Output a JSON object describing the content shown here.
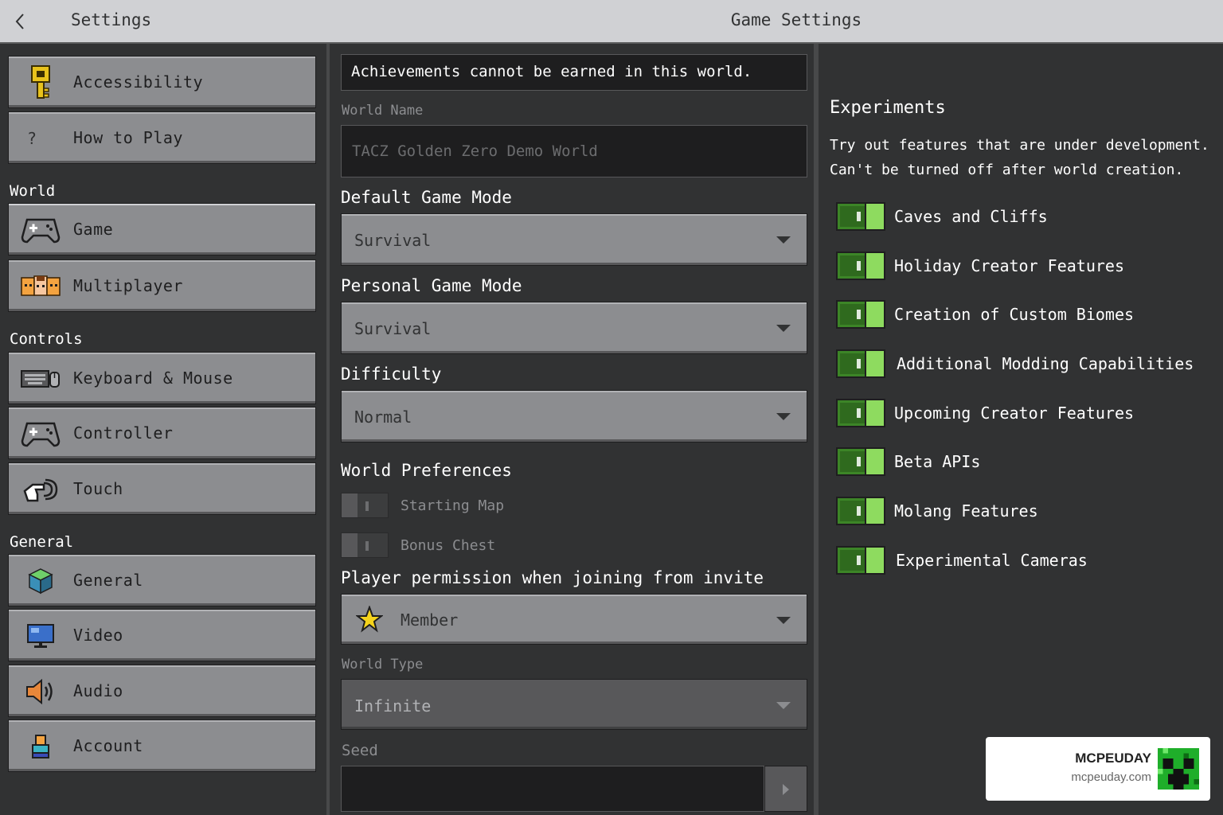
{
  "header": {
    "back_icon": "chevron-left-icon",
    "left_title": "Settings",
    "title": "Game Settings"
  },
  "sidebar": {
    "top_items": [
      {
        "label": "Accessibility",
        "icon": "key-icon"
      },
      {
        "label": "How to Play",
        "icon": "question-icon"
      }
    ],
    "sections": [
      {
        "heading": "World",
        "items": [
          {
            "label": "Game",
            "icon": "gamepad-icon",
            "selected": true
          },
          {
            "label": "Multiplayer",
            "icon": "players-icon"
          }
        ]
      },
      {
        "heading": "Controls",
        "items": [
          {
            "label": "Keyboard & Mouse",
            "icon": "keyboard-mouse-icon"
          },
          {
            "label": "Controller",
            "icon": "controller-icon"
          },
          {
            "label": "Touch",
            "icon": "touch-hand-icon"
          }
        ]
      },
      {
        "heading": "General",
        "items": [
          {
            "label": "General",
            "icon": "cube-icon"
          },
          {
            "label": "Video",
            "icon": "monitor-icon"
          },
          {
            "label": "Audio",
            "icon": "speaker-icon"
          },
          {
            "label": "Account",
            "icon": "account-icon"
          }
        ]
      }
    ]
  },
  "game": {
    "notice": "Achievements cannot be earned in this world.",
    "world_name_label": "World Name",
    "world_name_value": "TACZ Golden Zero Demo World",
    "default_mode_label": "Default Game Mode",
    "default_mode_value": "Survival",
    "personal_mode_label": "Personal Game Mode",
    "personal_mode_value": "Survival",
    "difficulty_label": "Difficulty",
    "difficulty_value": "Normal",
    "preferences_label": "World Preferences",
    "starting_map_label": "Starting Map",
    "starting_map_on": false,
    "bonus_chest_label": "Bonus Chest",
    "bonus_chest_on": false,
    "permission_label": "Player permission when joining from invite",
    "permission_value": "Member",
    "permission_icon": "star-icon",
    "world_type_label": "World Type",
    "world_type_value": "Infinite",
    "seed_label": "Seed",
    "seed_value": ""
  },
  "experiments": {
    "title": "Experiments",
    "desc_line1": "Try out features that are under development.",
    "desc_line2": "Can't be turned off after world creation.",
    "toggles": [
      {
        "label": "Caves and Cliffs",
        "on": true
      },
      {
        "label": "Holiday Creator Features",
        "on": true
      },
      {
        "label": "Creation of Custom Biomes",
        "on": true
      },
      {
        "label": "Additional Modding Capabilities",
        "on": true
      },
      {
        "label": "Upcoming Creator Features",
        "on": true
      },
      {
        "label": "Beta APIs",
        "on": true
      },
      {
        "label": "Molang Features",
        "on": true
      },
      {
        "label": "Experimental Cameras",
        "on": true
      }
    ]
  },
  "watermark": {
    "brand": "MCPEUDAY",
    "url": "mcpeuday.com",
    "logo_icon": "creeper-logo-icon"
  },
  "colors": {
    "toggle_on": "#3c8527",
    "toggle_knob": "#8edb5f",
    "button": "#8c8d90",
    "background": "#313233"
  }
}
